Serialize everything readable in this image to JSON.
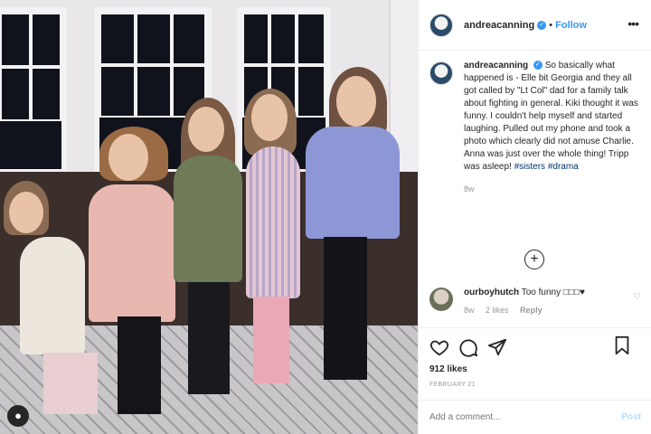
{
  "header": {
    "username": "andreacanning",
    "verified_mark": "✓",
    "separator": "•",
    "follow_label": "Follow",
    "more_icon": "more-horizontal-icon"
  },
  "caption": {
    "username": "andreacanning",
    "text": "So basically what happened is - Elle bit Georgia and they all got called by \"Lt Col\" dad for a family talk about fighting in general. Kiki thought it was funny. I couldn't help myself and started laughing. Pulled out my phone and took a photo which clearly did not amuse Charlie. Anna was just over the whole thing! Tripp was asleep!",
    "tags": [
      "#sisters",
      "#drama"
    ],
    "time": "8w"
  },
  "load_more_label": "+",
  "comment": {
    "username": "ourboyhutch",
    "text": "Too funny □□□♥",
    "time": "8w",
    "likes": "2 likes",
    "reply_label": "Reply"
  },
  "actions": {
    "likes": "912 likes",
    "date": "FEBRUARY 21"
  },
  "add_comment": {
    "placeholder": "Add a comment...",
    "post_label": "Post"
  },
  "colors": {
    "link_blue": "#3897f0",
    "hashtag": "#003569",
    "muted": "#999999"
  }
}
